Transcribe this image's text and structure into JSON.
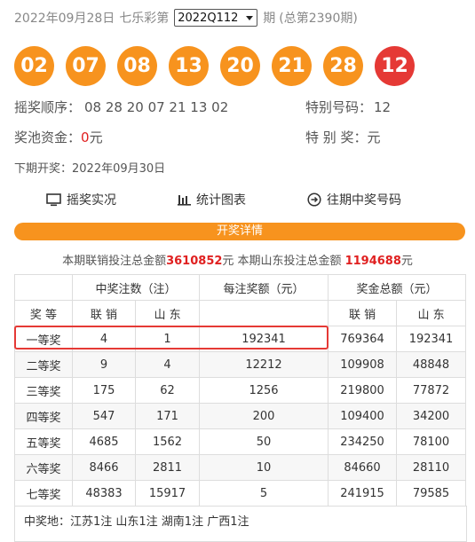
{
  "header": {
    "date": "2022年09月28日",
    "game": "七乐彩第",
    "issue_select": "2022Q112",
    "suffix": "期",
    "total": "(总第2390期)"
  },
  "balls": [
    {
      "num": "02",
      "color": "#f7931e"
    },
    {
      "num": "07",
      "color": "#f7931e"
    },
    {
      "num": "08",
      "color": "#f7931e"
    },
    {
      "num": "13",
      "color": "#f7931e"
    },
    {
      "num": "20",
      "color": "#f7931e"
    },
    {
      "num": "21",
      "color": "#f7931e"
    },
    {
      "num": "28",
      "color": "#f7931e"
    },
    {
      "num": "12",
      "color": "#e53935"
    }
  ],
  "info": {
    "order_label": "摇奖顺序：",
    "order_value": "08 28 20 07 21 13 02",
    "special_label": "特别号码：",
    "special_value": "12",
    "pool_label": "奖池资金：",
    "pool_value": "0",
    "pool_unit": "元",
    "special_prize_label": "特 别 奖：",
    "special_prize_unit": "元",
    "next_label": "下期开奖：",
    "next_value": "2022年09月30日"
  },
  "links": {
    "live": "摇奖实况",
    "chart": "统计图表",
    "history": "往期中奖号码"
  },
  "details_bar": "开奖详情",
  "totals": {
    "a": "本期联销投注总金额",
    "a_val": "3610852",
    "a_unit": "元 本期山东投注总金额",
    "b_val": "1194688",
    "b_unit": "元"
  },
  "table": {
    "h_winners": "中奖注数（注）",
    "h_per": "每注奖额（元）",
    "h_total": "奖金总额（元）",
    "h_level": "奖 等",
    "h_lian1": "联 销",
    "h_shan1": "山 东",
    "h_lian2": "联 销",
    "h_shan2": "山 东",
    "rows": [
      {
        "level": "一等奖",
        "w_lian": "4",
        "w_shan": "1",
        "per": "192341",
        "t_lian": "769364",
        "t_shan": "192341"
      },
      {
        "level": "二等奖",
        "w_lian": "9",
        "w_shan": "4",
        "per": "12212",
        "t_lian": "109908",
        "t_shan": "48848"
      },
      {
        "level": "三等奖",
        "w_lian": "175",
        "w_shan": "62",
        "per": "1256",
        "t_lian": "219800",
        "t_shan": "77872"
      },
      {
        "level": "四等奖",
        "w_lian": "547",
        "w_shan": "171",
        "per": "200",
        "t_lian": "109400",
        "t_shan": "34200"
      },
      {
        "level": "五等奖",
        "w_lian": "4685",
        "w_shan": "1562",
        "per": "50",
        "t_lian": "234250",
        "t_shan": "78100"
      },
      {
        "level": "六等奖",
        "w_lian": "8466",
        "w_shan": "2811",
        "per": "10",
        "t_lian": "84660",
        "t_shan": "28110"
      },
      {
        "level": "七等奖",
        "w_lian": "48383",
        "w_shan": "15917",
        "per": "5",
        "t_lian": "241915",
        "t_shan": "79585"
      }
    ]
  },
  "footer": "中奖地：江苏1注 山东1注 湖南1注 广西1注"
}
